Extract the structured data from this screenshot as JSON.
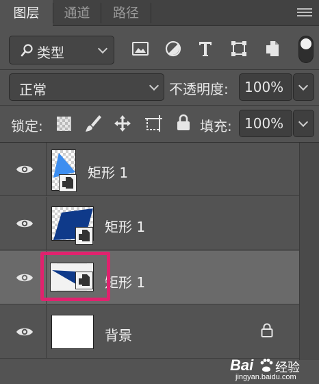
{
  "tabs": [
    {
      "label": "图层",
      "active": true
    },
    {
      "label": "通道",
      "active": false
    },
    {
      "label": "路径",
      "active": false
    }
  ],
  "filter": {
    "label": "类型",
    "icons": [
      "image-filter-icon",
      "adjustment-filter-icon",
      "type-filter-icon",
      "shape-filter-icon",
      "smart-object-filter-icon"
    ]
  },
  "blend": {
    "mode": "正常",
    "opacity_label": "不透明度:",
    "opacity_value": "100%"
  },
  "lock": {
    "label": "锁定:",
    "fill_label": "填充:",
    "fill_value": "100%"
  },
  "layers": [
    {
      "name": "矩形 1",
      "selected": false,
      "type": "smart-object"
    },
    {
      "name": "矩形 1",
      "selected": false,
      "type": "smart-object"
    },
    {
      "name": "矩形 1",
      "selected": true,
      "type": "smart-object"
    },
    {
      "name": "背景",
      "selected": false,
      "type": "background",
      "locked": true
    }
  ],
  "colors": {
    "accent_highlight": "#e0226e",
    "shape_light_blue": "#3d8ef0",
    "shape_dark_blue": "#0f3a8a"
  },
  "watermark": {
    "brand": "Bai",
    "suffix": "经验",
    "url": "jingyan.baidu.com"
  }
}
